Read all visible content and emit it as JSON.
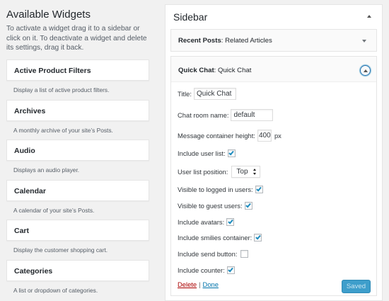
{
  "available_widgets": {
    "title": "Available Widgets",
    "description": "To activate a widget drag it to a sidebar or click on it. To deactivate a widget and delete its settings, drag it back.",
    "items": [
      {
        "name": "Active Product Filters",
        "desc": "Display a list of active product filters."
      },
      {
        "name": "Archives",
        "desc": "A monthly archive of your site’s Posts."
      },
      {
        "name": "Audio",
        "desc": "Displays an audio player."
      },
      {
        "name": "Calendar",
        "desc": "A calendar of your site’s Posts."
      },
      {
        "name": "Cart",
        "desc": "Display the customer shopping cart."
      },
      {
        "name": "Categories",
        "desc": "A list or dropdown of categories."
      }
    ]
  },
  "sidebar": {
    "title": "Sidebar",
    "recent_posts": {
      "name": "Recent Posts",
      "instance": ": Related Articles"
    },
    "quick_chat": {
      "name": "Quick Chat",
      "instance": ": Quick Chat",
      "fields": {
        "title_label": "Title:",
        "title_value": "Quick Chat",
        "room_label": "Chat room name:",
        "room_value": "default",
        "height_label": "Message container height:",
        "height_value": "400",
        "height_unit": "px",
        "user_list_label": "Include user list:",
        "user_list_checked": true,
        "position_label": "User list position:",
        "position_value": "Top",
        "logged_label": "Visible to logged in users:",
        "logged_checked": true,
        "guest_label": "Visible to guest users:",
        "guest_checked": true,
        "avatars_label": "Include avatars:",
        "avatars_checked": true,
        "smilies_label": "Include smilies container:",
        "smilies_checked": true,
        "send_label": "Include send button:",
        "send_checked": false,
        "counter_label": "Include counter:",
        "counter_checked": true
      },
      "delete_label": "Delete",
      "separator": "|",
      "done_label": "Done",
      "saved_label": "Saved"
    }
  },
  "colors": {
    "accent": "#0073aa",
    "delete": "#aa0000",
    "button": "#3e9ecb"
  }
}
